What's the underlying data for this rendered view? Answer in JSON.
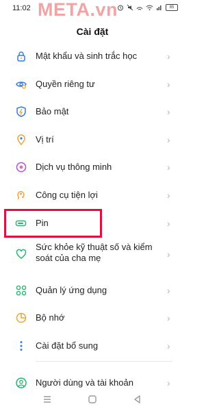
{
  "status": {
    "time": "11:02",
    "battery": "85"
  },
  "watermark": "META.vn",
  "header": {
    "title": "Cài đặt"
  },
  "items": [
    {
      "label": "Mật khẩu và sinh trắc học",
      "icon": "lock-icon"
    },
    {
      "label": "Quyền riêng tư",
      "icon": "privacy-icon"
    },
    {
      "label": "Bảo mật",
      "icon": "shield-icon"
    },
    {
      "label": "Vị trí",
      "icon": "location-pin-icon"
    },
    {
      "label": "Dịch vụ thông minh",
      "icon": "smart-service-icon"
    },
    {
      "label": "Công cụ tiện lợi",
      "icon": "tools-icon"
    },
    {
      "label": "Pin",
      "icon": "battery-icon"
    },
    {
      "label": "Sức khỏe kỹ thuật số và kiểm soát của cha mẹ",
      "icon": "digital-wellbeing-icon"
    },
    {
      "label": "Quản lý ứng dụng",
      "icon": "apps-icon"
    },
    {
      "label": "Bộ nhớ",
      "icon": "storage-icon"
    },
    {
      "label": "Cài đặt bổ sung",
      "icon": "more-settings-icon"
    },
    {
      "label": "Người dùng và tài khoản",
      "icon": "user-account-icon"
    }
  ],
  "colors": {
    "highlight": "#e0103c",
    "accent": "#2f7de1"
  }
}
